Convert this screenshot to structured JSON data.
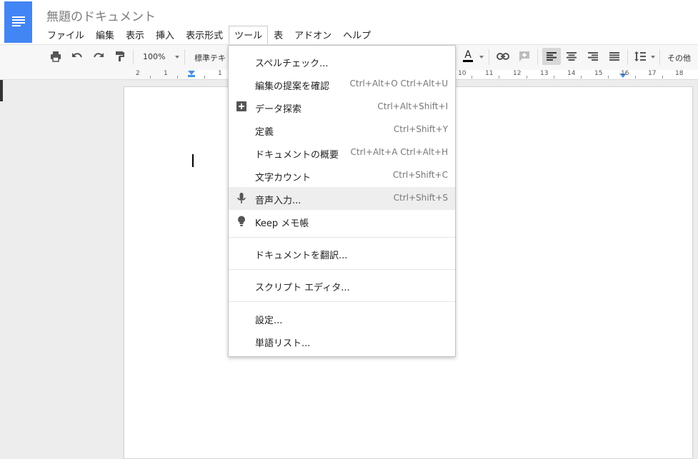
{
  "document": {
    "title": "無題のドキュメント"
  },
  "menubar": {
    "items": [
      "ファイル",
      "編集",
      "表示",
      "挿入",
      "表示形式",
      "ツール",
      "表",
      "アドオン",
      "ヘルプ"
    ],
    "open_index": 5
  },
  "toolbar": {
    "zoom": "100%",
    "style": "標準テキ",
    "text_color_letter": "A",
    "more": "その他",
    "icons": [
      "print-icon",
      "undo-icon",
      "redo-icon",
      "paint-format-icon",
      "link-icon",
      "add-comment-icon",
      "align-left-icon",
      "align-center-icon",
      "align-right-icon",
      "align-justify-icon",
      "line-spacing-icon"
    ]
  },
  "ruler": {
    "ticks": [
      "2",
      "1",
      "1",
      "10",
      "11",
      "12",
      "13",
      "14",
      "15",
      "16",
      "17",
      "18"
    ]
  },
  "tools_menu": {
    "items": [
      {
        "label": "スペルチェック...",
        "shortcut": "",
        "icon": ""
      },
      {
        "label": "編集の提案を確認",
        "shortcut": "Ctrl+Alt+O Ctrl+Alt+U",
        "icon": ""
      },
      {
        "label": "データ探索",
        "shortcut": "Ctrl+Alt+Shift+I",
        "icon": "explore-plus-icon"
      },
      {
        "label": "定義",
        "shortcut": "Ctrl+Shift+Y",
        "icon": ""
      },
      {
        "label": "ドキュメントの概要",
        "shortcut": "Ctrl+Alt+A Ctrl+Alt+H",
        "icon": ""
      },
      {
        "label": "文字カウント",
        "shortcut": "Ctrl+Shift+C",
        "icon": ""
      },
      {
        "label": "音声入力...",
        "shortcut": "Ctrl+Shift+S",
        "icon": "microphone-icon",
        "highlighted": true
      },
      {
        "label": "Keep メモ帳",
        "shortcut": "",
        "icon": "lightbulb-icon"
      },
      {
        "label": "ドキュメントを翻訳...",
        "shortcut": "",
        "icon": ""
      },
      {
        "label": "スクリプト エディタ...",
        "shortcut": "",
        "icon": ""
      },
      {
        "label": "設定...",
        "shortcut": "",
        "icon": ""
      },
      {
        "label": "単語リスト...",
        "shortcut": "",
        "icon": ""
      }
    ]
  },
  "colors": {
    "brand": "#4285f4",
    "text_color_underline": "#000000",
    "highlight": "#eeeeee"
  }
}
